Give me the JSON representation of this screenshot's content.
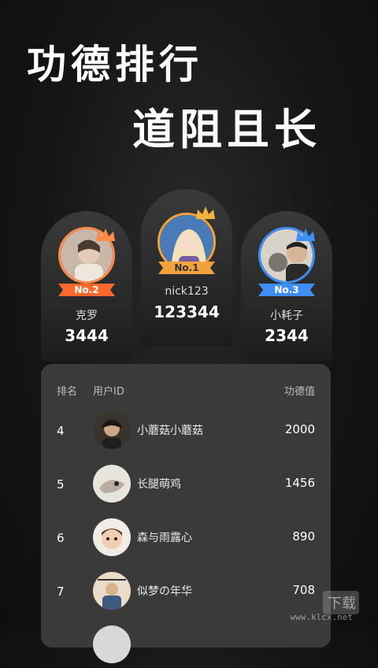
{
  "headline": {
    "line1": "功德排行",
    "line2": "道阻且长"
  },
  "podium": [
    {
      "rank_label": "No.1",
      "name": "nick123",
      "score": "123344",
      "color": "#f2a23c"
    },
    {
      "rank_label": "No.2",
      "name": "克罗",
      "score": "3444",
      "color": "#ff8a4c"
    },
    {
      "rank_label": "No.3",
      "name": "小耗子",
      "score": "2344",
      "color": "#3e8ef5"
    }
  ],
  "board": {
    "headers": {
      "rank": "排名",
      "user": "用户ID",
      "score": "功德值"
    },
    "rows": [
      {
        "rank": "4",
        "name": "小蘑菇小蘑菇",
        "score": "2000"
      },
      {
        "rank": "5",
        "name": "长腿萌鸡",
        "score": "1456"
      },
      {
        "rank": "6",
        "name": "森与雨露心",
        "score": "890"
      },
      {
        "rank": "7",
        "name": "似梦の年华",
        "score": "708"
      }
    ]
  },
  "watermark": {
    "text": "www.klcx.net"
  }
}
